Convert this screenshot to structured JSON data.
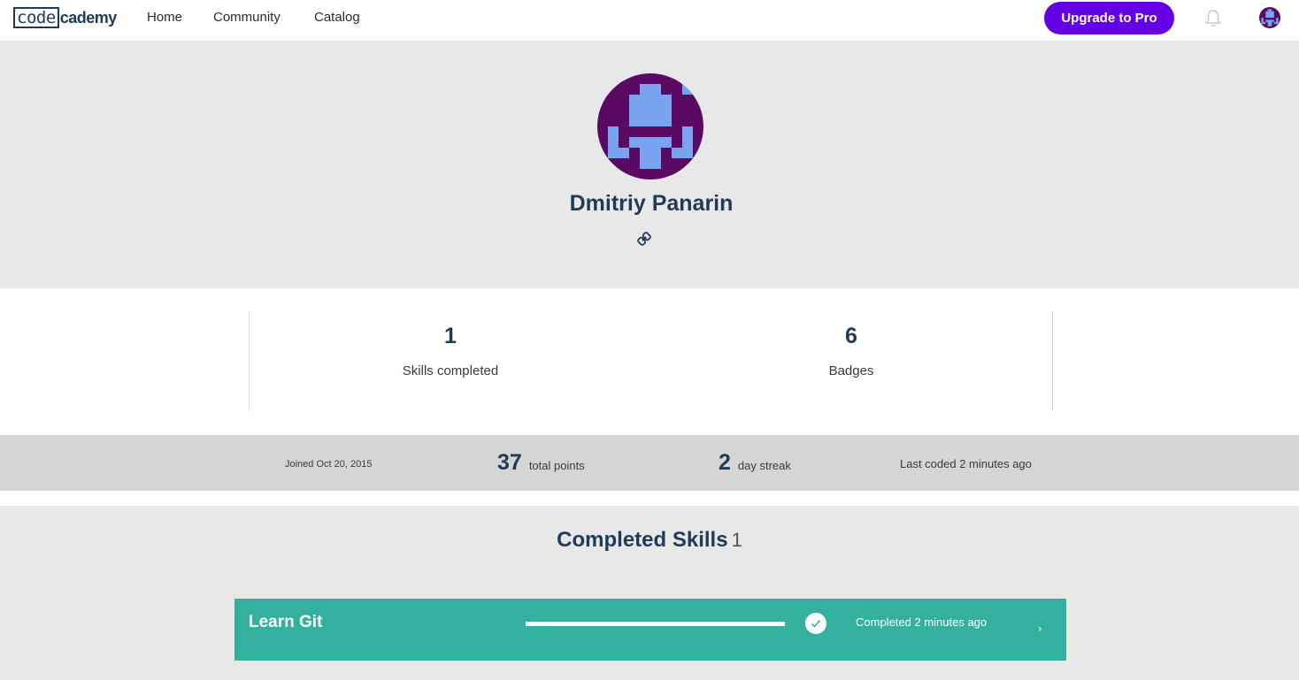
{
  "nav": {
    "logo_box": "code",
    "logo_rest": "cademy",
    "links": [
      "Home",
      "Community",
      "Catalog"
    ],
    "upgrade_label": "Upgrade to Pro",
    "icons": [
      "bell-icon",
      "user-avatar"
    ]
  },
  "profile": {
    "name": "Dmitriy Panarin",
    "link_icon": "link-icon"
  },
  "stats": {
    "skills_count": "1",
    "skills_label": "Skills completed",
    "badges_count": "6",
    "badges_label": "Badges"
  },
  "meta": {
    "joined": "Joined Oct 20, 2015",
    "points_value": "37",
    "points_label": "total points",
    "streak_value": "2",
    "streak_label": "day streak",
    "last_coded": "Last coded 2 minutes ago"
  },
  "skills": {
    "title": "Completed Skills",
    "count": "1",
    "items": [
      {
        "name": "Learn Git",
        "progress": 1.0,
        "status": "Completed 2 minutes ago",
        "chevron": "›"
      }
    ]
  },
  "colors": {
    "brand_purple": "#6400e4",
    "avatar_dark": "#5a0a63",
    "avatar_light": "#78a3ee",
    "skill_green": "#33b19e",
    "text_navy": "#1f3b57"
  }
}
